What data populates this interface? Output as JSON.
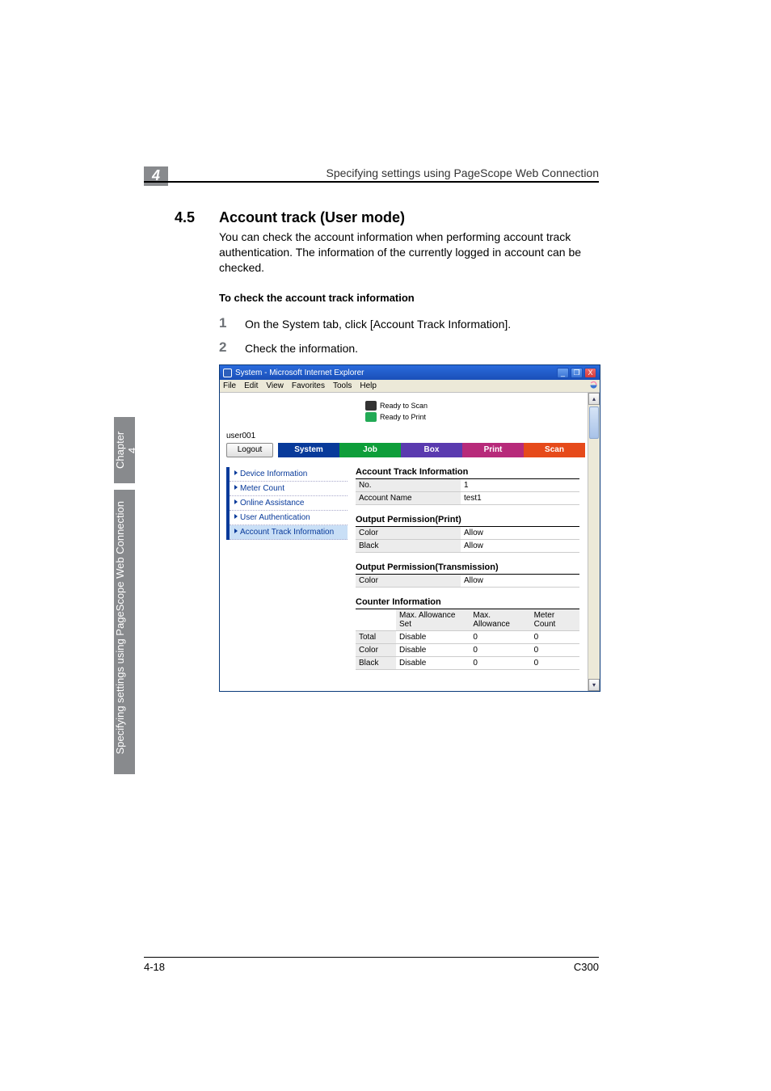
{
  "header": {
    "right_text": "Specifying settings using PageScope Web Connection",
    "chapter_num": "4"
  },
  "section": {
    "number": "4.5",
    "title": "Account track (User mode)",
    "paragraph": "You can check the account information when performing account track authentication. The information of the currently logged in account can be checked.",
    "sub_title": "To check the account track information",
    "steps": [
      {
        "num": "1",
        "text": "On the System tab, click [Account Track Information]."
      },
      {
        "num": "2",
        "text": "Check the information."
      }
    ]
  },
  "screenshot": {
    "title": "System - Microsoft Internet Explorer",
    "menu": [
      "File",
      "Edit",
      "View",
      "Favorites",
      "Tools",
      "Help"
    ],
    "status": {
      "scan": "Ready to Scan",
      "print": "Ready to Print"
    },
    "loggedin": "user001",
    "logout": "Logout",
    "tabs": {
      "system": "System",
      "job": "Job",
      "box": "Box",
      "print": "Print",
      "scan": "Scan"
    },
    "sidebar": [
      "Device Information",
      "Meter Count",
      "Online Assistance",
      "User Authentication",
      "Account Track Information"
    ],
    "panel": {
      "title": "Account Track Information",
      "no_label": "No.",
      "no_value": "1",
      "accname_label": "Account Name",
      "accname_value": "test1",
      "op_print_title": "Output Permission(Print)",
      "op_print_rows": [
        {
          "k": "Color",
          "v": "Allow"
        },
        {
          "k": "Black",
          "v": "Allow"
        }
      ],
      "op_trans_title": "Output Permission(Transmission)",
      "op_trans_rows": [
        {
          "k": "Color",
          "v": "Allow"
        }
      ],
      "counter_title": "Counter Information",
      "counter_headers": [
        "",
        "Max. Allowance Set",
        "Max. Allowance",
        "Meter Count"
      ],
      "counter_rows": [
        {
          "label": "Total",
          "set": "Disable",
          "allow": "0",
          "meter": "0"
        },
        {
          "label": "Color",
          "set": "Disable",
          "allow": "0",
          "meter": "0"
        },
        {
          "label": "Black",
          "set": "Disable",
          "allow": "0",
          "meter": "0"
        }
      ]
    },
    "controls": {
      "min": "_",
      "max": "❐",
      "close": "X"
    }
  },
  "side_tab": {
    "top": "Chapter 4",
    "bottom": "Specifying settings using PageScope Web Connection"
  },
  "footer": {
    "left": "4-18",
    "right": "C300"
  }
}
